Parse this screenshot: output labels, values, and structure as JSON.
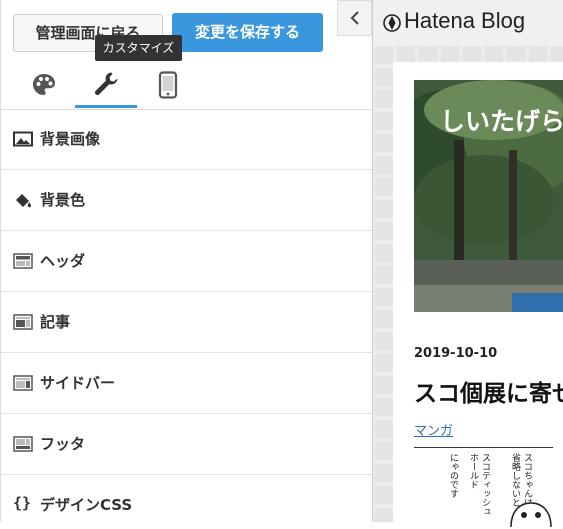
{
  "toolbar": {
    "back_label": "管理画面に戻る",
    "save_label": "変更を保存する",
    "tooltip": "カスタマイズ"
  },
  "tabs": [
    {
      "icon": "palette-icon",
      "active": false
    },
    {
      "icon": "wrench-icon",
      "active": true
    },
    {
      "icon": "smartphone-icon",
      "active": false
    }
  ],
  "menu": [
    {
      "label": "背景画像",
      "icon": "image-icon"
    },
    {
      "label": "背景色",
      "icon": "paint-bucket-icon"
    },
    {
      "label": "ヘッダ",
      "icon": "header-layout-icon"
    },
    {
      "label": "記事",
      "icon": "article-layout-icon"
    },
    {
      "label": "サイドバー",
      "icon": "sidebar-layout-icon"
    },
    {
      "label": "フッタ",
      "icon": "footer-layout-icon"
    },
    {
      "label": "デザインCSS",
      "icon": "braces-icon"
    }
  ],
  "preview": {
    "blog_name": "Hatena Blog",
    "hero_title": "しいたげら",
    "post_date": "2019-10-10",
    "post_title": "スコ個展に寄せ",
    "category": "マンガ",
    "manga_text": [
      "スコちゃんは",
      "省略しないと",
      "スコティッシュ",
      "ホールド",
      "にゃのです"
    ]
  },
  "colors": {
    "accent": "#3a97de",
    "tooltip_bg": "#333333"
  }
}
